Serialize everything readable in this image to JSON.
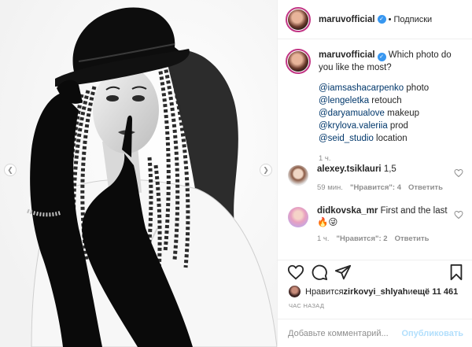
{
  "post": {
    "photo_alt_visible": "",
    "carousel": {
      "total_slides": 3,
      "active_slide": 1
    }
  },
  "header": {
    "username": "maruvofficial",
    "verified": true,
    "separator": "•",
    "follow_label": "Подписки"
  },
  "caption": {
    "username": "maruvofficial",
    "text": "Which photo do you like the most?",
    "credits": [
      {
        "mention": "@iamsashacarpenko",
        "role": " photo"
      },
      {
        "mention": "@lengeletka",
        "role": " retouch"
      },
      {
        "mention": "@daryamualove",
        "role": " makeup"
      },
      {
        "mention": "@krylova.valeriia",
        "role": " prod"
      },
      {
        "mention": "@seid_studio",
        "role": " location"
      }
    ],
    "time": "1 ч."
  },
  "comments": [
    {
      "username": "alexey.tsiklauri",
      "text": "1,5",
      "time": "59 мин.",
      "likes": "\"Нравится\": 4",
      "reply": "Ответить"
    },
    {
      "username": "didkovska_mr",
      "text": "First and the last",
      "emoji": "🔥😜",
      "time": "1 ч.",
      "likes": "\"Нравится\": 2",
      "reply": "Ответить"
    }
  ],
  "actions": {
    "icons": [
      "heart-icon",
      "comment-icon",
      "share-icon",
      "bookmark-icon"
    ]
  },
  "likes": {
    "prefix": "Нравится ",
    "user": "zirkovyi_shlyah",
    "middle": " и ",
    "count": "ещё 11 461"
  },
  "timestamp": "ЧАС НАЗАД",
  "add_comment": {
    "placeholder": "Добавьте комментарий...",
    "publish_label": "Опубликовать"
  },
  "colors": {
    "link_blue": "#3897f0",
    "mention": "#00376b",
    "muted": "#8e8e8e",
    "publish_disabled": "#b2dffc",
    "story_ring": "#c13584"
  }
}
